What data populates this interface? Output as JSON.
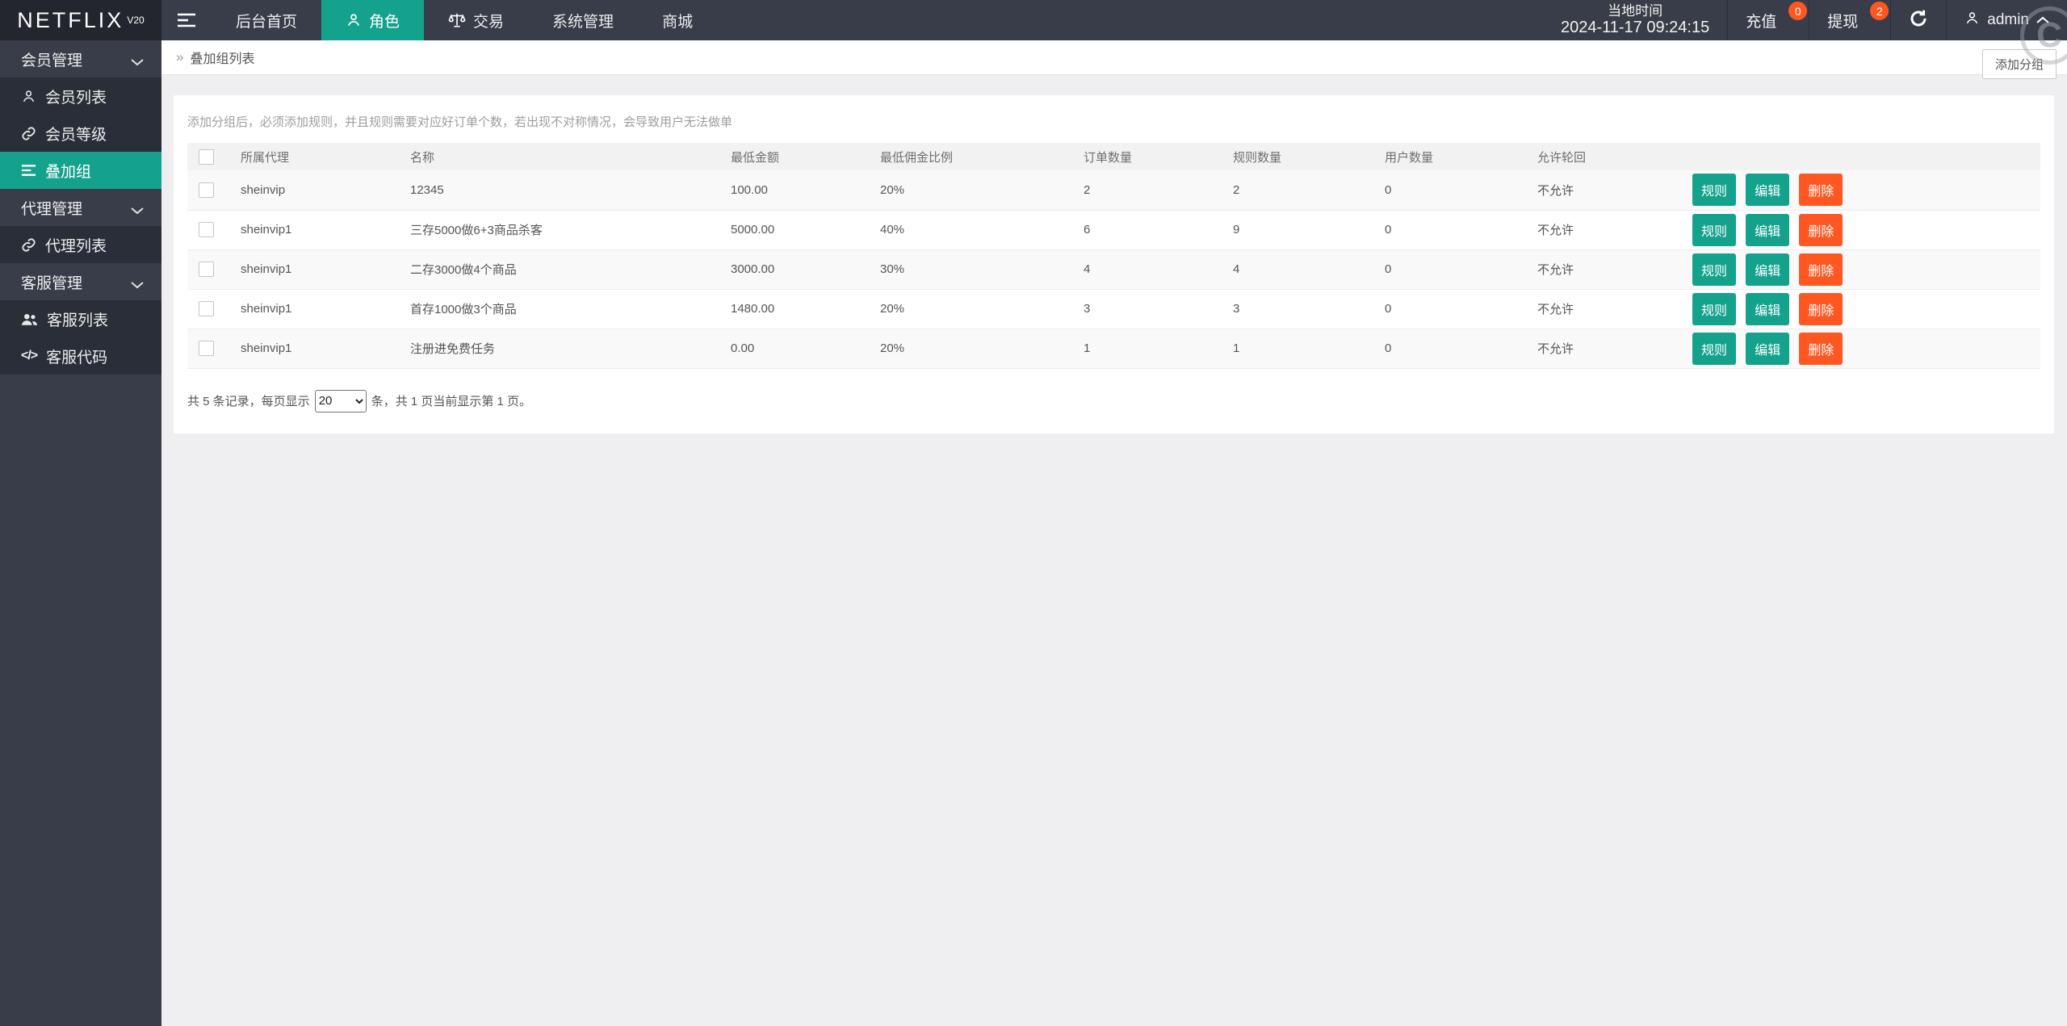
{
  "topbar": {
    "logo": "NETFLIX",
    "logo_sup": "V20",
    "nav": [
      {
        "label": "后台首页"
      },
      {
        "label": "角色"
      },
      {
        "label": "交易"
      },
      {
        "label": "系统管理"
      },
      {
        "label": "商城"
      }
    ],
    "local_time_label": "当地时间",
    "local_time_value": "2024-11-17 09:24:15",
    "recharge_label": "充值",
    "recharge_badge": "0",
    "withdraw_label": "提现",
    "withdraw_badge": "2",
    "user": "admin"
  },
  "sidebar": {
    "items": [
      {
        "label": "会员管理"
      },
      {
        "label": "会员列表"
      },
      {
        "label": "会员等级"
      },
      {
        "label": "叠加组"
      },
      {
        "label": "代理管理"
      },
      {
        "label": "代理列表"
      },
      {
        "label": "客服管理"
      },
      {
        "label": "客服列表"
      },
      {
        "label": "客服代码"
      }
    ]
  },
  "breadcrumb": {
    "title": "叠加组列表",
    "add_button": "添加分组"
  },
  "main": {
    "hint": "添加分组后，必须添加规则，并且规则需要对应好订单个数，若出现不对称情况，会导致用户无法做单",
    "table": {
      "headers": [
        "所属代理",
        "名称",
        "最低金额",
        "最低佣金比例",
        "订单数量",
        "规则数量",
        "用户数量",
        "允许轮回",
        ""
      ],
      "action_labels": {
        "rule": "规则",
        "edit": "编辑",
        "delete": "删除"
      },
      "rows": [
        {
          "agent": "sheinvip",
          "name": "12345",
          "min_amount": "100.00",
          "min_commission": "20%",
          "orders": "2",
          "rules": "2",
          "users": "0",
          "cycle": "不允许"
        },
        {
          "agent": "sheinvip1",
          "name": "三存5000做6+3商品杀客",
          "min_amount": "5000.00",
          "min_commission": "40%",
          "orders": "6",
          "rules": "9",
          "users": "0",
          "cycle": "不允许"
        },
        {
          "agent": "sheinvip1",
          "name": "二存3000做4个商品",
          "min_amount": "3000.00",
          "min_commission": "30%",
          "orders": "4",
          "rules": "4",
          "users": "0",
          "cycle": "不允许"
        },
        {
          "agent": "sheinvip1",
          "name": "首存1000做3个商品",
          "min_amount": "1480.00",
          "min_commission": "20%",
          "orders": "3",
          "rules": "3",
          "users": "0",
          "cycle": "不允许"
        },
        {
          "agent": "sheinvip1",
          "name": "注册进免费任务",
          "min_amount": "0.00",
          "min_commission": "20%",
          "orders": "1",
          "rules": "1",
          "users": "0",
          "cycle": "不允许"
        }
      ]
    },
    "pagination": {
      "prefix": "共 5 条记录，每页显示",
      "per_page": "20",
      "suffix": "条，共 1 页当前显示第 1 页。"
    }
  },
  "colors": {
    "accent": "#14A28D",
    "danger": "#FF5722",
    "topbar": "#393D49",
    "logo_bg": "#23262E"
  }
}
